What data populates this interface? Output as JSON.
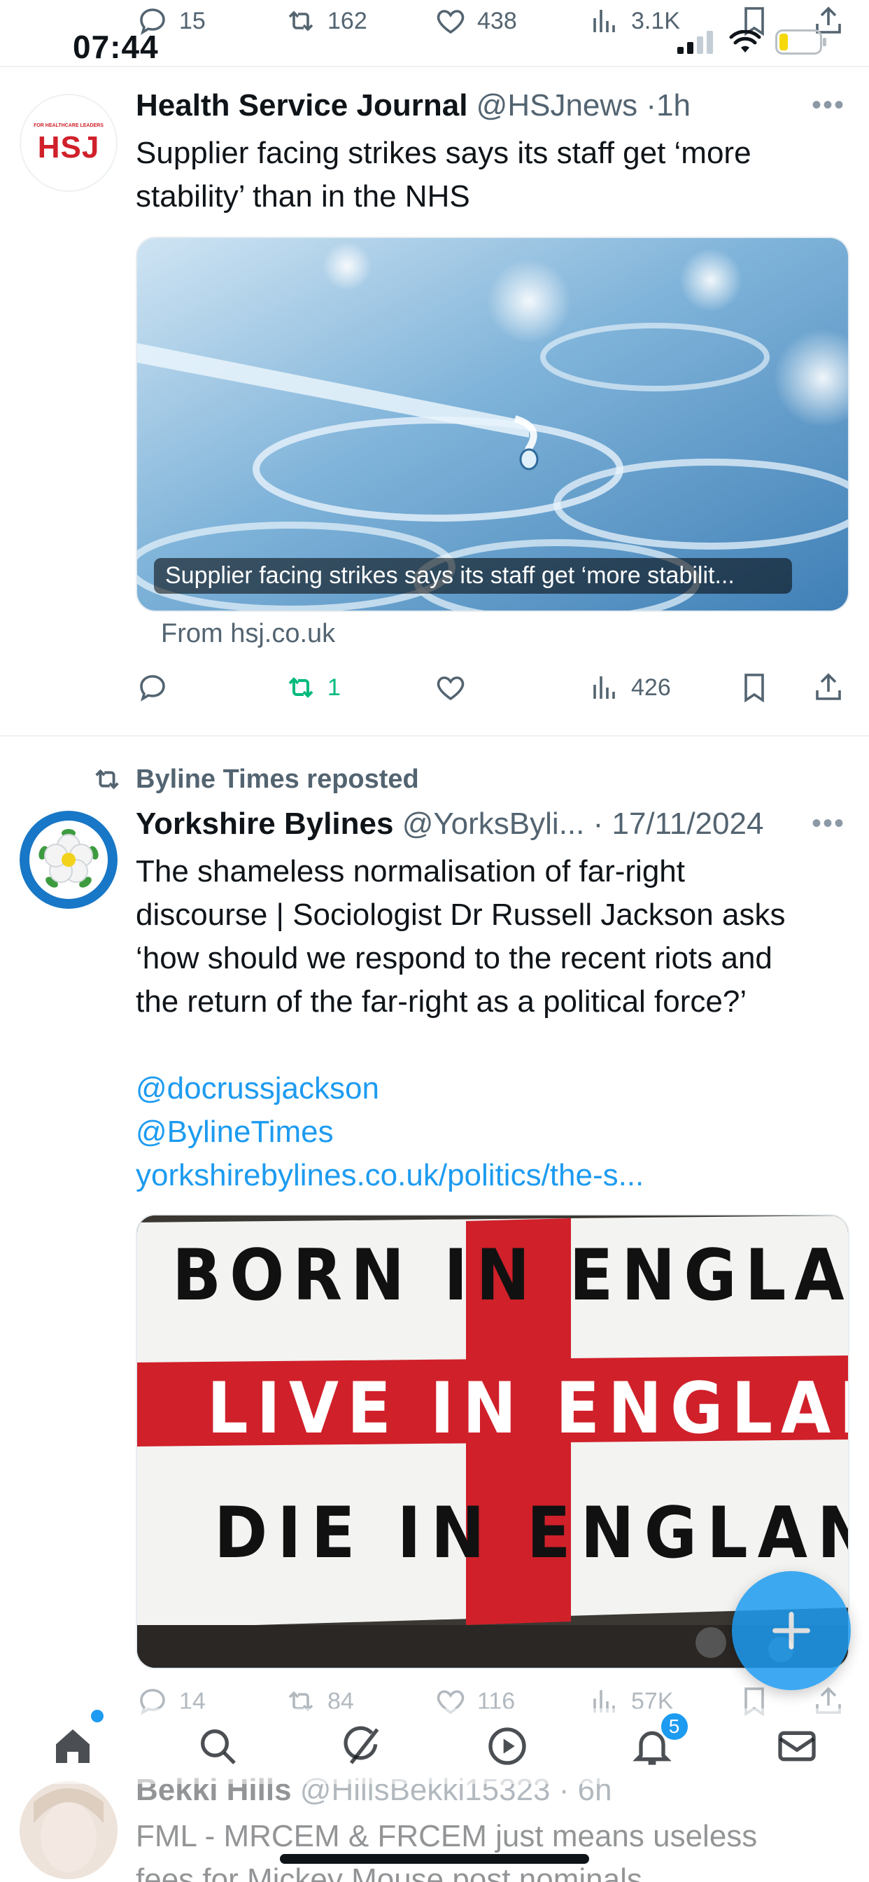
{
  "status_bar": {
    "time": "07:44"
  },
  "top_actions": {
    "replies": "15",
    "reposts": "162",
    "likes": "438",
    "views": "3.1K"
  },
  "tweet1": {
    "avatar_text": "HSJ",
    "avatar_subtext": "FOR HEALTHCARE LEADERS",
    "name": "Health Service Journal",
    "handle": "@HSJnews",
    "time": "1h",
    "text": "Supplier facing strikes says its staff get ‘more stability’ than in the NHS",
    "card_caption": "Supplier facing strikes says its staff get ‘more stabilit...",
    "from": "From hsj.co.uk",
    "reposts": "1",
    "views": "426"
  },
  "tweet2": {
    "repost_label": "Byline Times reposted",
    "name": "Yorkshire Bylines",
    "handle": "@YorksByli...",
    "time": "17/11/2024",
    "text_line1": "The shameless normalisation of far-right",
    "text_line2": "discourse | Sociologist Dr Russell Jackson asks",
    "text_line3": "‘how should we respond to the recent riots and",
    "text_line4": "the return of the far-right as a political force?’",
    "mention1": "@docrussjackson",
    "mention2": "@BylineTimes",
    "url": "yorkshirebylines.co.uk/politics/the-s...",
    "banner_line1": "BORN IN ENGLAND",
    "banner_line2": "LIVE IN ENGLAND",
    "banner_line3": "DIE IN ENGLAND",
    "replies": "14",
    "reposts": "84",
    "likes": "116",
    "views": "57K"
  },
  "tweet3": {
    "name": "Bekki Hills",
    "handle": "@HillsBekki15323",
    "time": "6h",
    "text": "FML - MRCEM & FRCEM just means useless",
    "text2": "fees for Mickey Mouse post nominals"
  },
  "nav": {
    "notifications_badge": "5"
  },
  "icons": [
    "reply-icon",
    "repost-icon",
    "like-icon",
    "views-icon",
    "bookmark-icon",
    "share-icon",
    "home-icon",
    "search-icon",
    "grok-icon",
    "video-icon",
    "notifications-icon",
    "messages-icon"
  ],
  "colors": {
    "accent": "#1d9bf0",
    "repost_active": "#00ba7c",
    "text_secondary": "#536471",
    "flag_red": "#d0202a"
  }
}
